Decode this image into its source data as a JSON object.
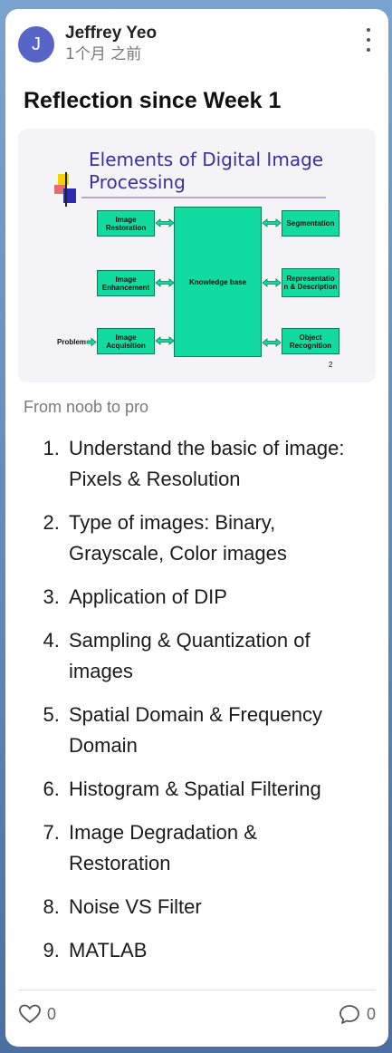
{
  "post": {
    "author": {
      "name": "Jeffrey Yeo",
      "initial": "J",
      "time": "1个月 之前"
    },
    "title": "Reflection since Week 1",
    "caption": "From noob to pro",
    "topics": [
      "Understand the basic of image: Pixels & Resolution",
      "Type of images: Binary, Grayscale, Color images",
      "Application of DIP",
      "Sampling & Quantization of images",
      "Spatial Domain & Frequency Domain",
      "Histogram & Spatial Filtering",
      "Image Degradation & Restoration",
      "Noise VS Filter",
      "MATLAB"
    ],
    "likes": "0",
    "comments": "0"
  },
  "diagram": {
    "title_line1": "Elements of Digital Image",
    "title_line2": "Processing",
    "center": "Knowledge base",
    "left": [
      "Image Restoration",
      "Image Enhancement",
      "Image Acquisition"
    ],
    "right": [
      "Segmentation",
      "Representatio n & Description",
      "Object Recognition"
    ],
    "input_label": "Problem",
    "page_number": "2"
  },
  "colors": {
    "avatar": "#5865c8",
    "diagram_box": "#12dba0",
    "diagram_title": "#3b2fa8"
  },
  "icons": {
    "more": "more-vertical-icon",
    "like": "heart-icon",
    "comment": "comment-bubble-icon"
  }
}
